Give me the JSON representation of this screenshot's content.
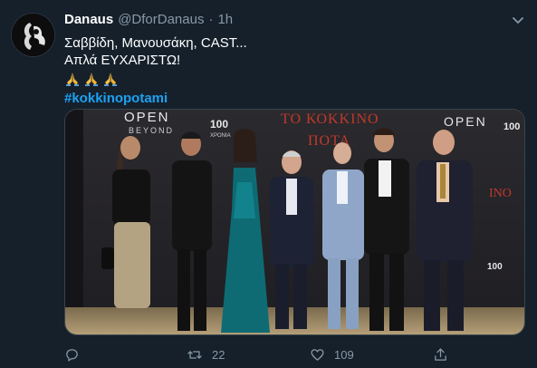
{
  "tweet": {
    "display_name": "Danaus",
    "handle": "@DforDanaus",
    "separator": "·",
    "time": "1h",
    "lines": [
      "Σαββίδη, Μανουσάκη, CAST...",
      "Απλά ΕΥΧΑΡΙΣΤΩ!"
    ],
    "emoji": "pray-hands-icon",
    "emoji_count": 3,
    "hashtag": "#kokkinopotami"
  },
  "media": {
    "backdrop_text_left": "OPEN",
    "backdrop_text_left_sub": "BEYOND",
    "backdrop_logo_number": "100",
    "backdrop_logo_sub": "ΧΡΟΝΙΑ",
    "backdrop_title": "ΤΟ ΚΟΚΚΙΝΟ",
    "backdrop_title_2": "ΠΟΤΑ",
    "backdrop_text_right": "OPEN",
    "backdrop_logo_number_right": "100",
    "backdrop_side_text": "ΙΝΟ",
    "backdrop_bottom_logo": "100"
  },
  "actions": {
    "replies": "",
    "retweets": "22",
    "likes": "109"
  },
  "colors": {
    "background": "#15202b",
    "muted": "#8899a6",
    "link": "#1da1f2",
    "backdrop_red": "#c0392b"
  }
}
